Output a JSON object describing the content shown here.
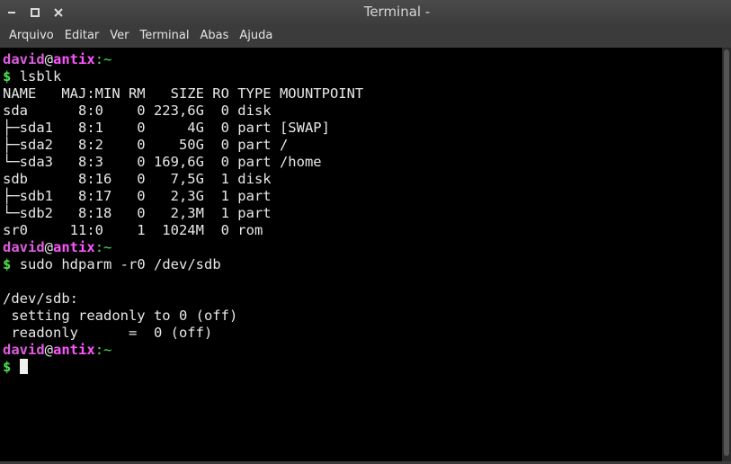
{
  "window": {
    "title": "Terminal -",
    "controls": [
      {
        "name": "close-window-button",
        "icon": "x-icon"
      },
      {
        "name": "maximize-window-button",
        "icon": "square-icon"
      },
      {
        "name": "minimize-window-button",
        "icon": "dash-icon"
      }
    ]
  },
  "menubar": {
    "items": [
      "Arquivo",
      "Editar",
      "Ver",
      "Terminal",
      "Abas",
      "Ajuda"
    ]
  },
  "terminal": {
    "user": "david",
    "at": "@",
    "host": "antix",
    "path": ":~",
    "prompt_symbol": "$",
    "commands": [
      "lsblk",
      "sudo hdparm -r0 /dev/sdb"
    ],
    "lsblk_output": [
      "NAME   MAJ:MIN RM   SIZE RO TYPE MOUNTPOINT",
      "sda      8:0    0 223,6G  0 disk ",
      "├─sda1   8:1    0     4G  0 part [SWAP]",
      "├─sda2   8:2    0    50G  0 part /",
      "└─sda3   8:3    0 169,6G  0 part /home",
      "sdb      8:16   0   7,5G  1 disk ",
      "├─sdb1   8:17   0   2,3G  1 part ",
      "└─sdb2   8:18   0   2,3M  1 part ",
      "sr0     11:0    1  1024M  0 rom  "
    ],
    "hdparm_output": [
      "",
      "/dev/sdb:",
      " setting readonly to 0 (off)",
      " readonly      =  0 (off)"
    ]
  },
  "colors": {
    "background": "#000000",
    "foreground": "#e8e8e8",
    "user": "#e05ce0",
    "host": "#ff55ff",
    "prompt_green": "#4ee24e",
    "chrome": "#3b3b3b"
  }
}
